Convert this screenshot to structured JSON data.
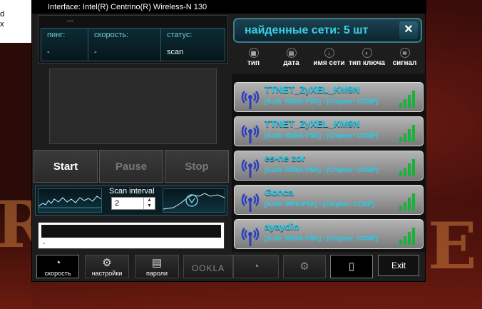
{
  "desktop": {
    "left_text_1": "d",
    "left_text_2": "x"
  },
  "window": {
    "title": "Interface:  Intel(R) Centrino(R) Wireless-N 130"
  },
  "connection": {
    "top_value": "---",
    "headers": [
      "пинг:",
      "скорость:",
      "статус:"
    ],
    "values": [
      "-",
      "-",
      "scan"
    ]
  },
  "controls": {
    "start": "Start",
    "pause": "Pause",
    "stop": "Stop"
  },
  "scan": {
    "label": "Scan interval",
    "value": "2"
  },
  "log": {
    "first_line": "-"
  },
  "networks_header": {
    "label": "найденные сети:",
    "count": "5",
    "unit": "шт"
  },
  "columns": [
    "тип",
    "дата",
    "имя сети",
    "тип ключа",
    "сигнал"
  ],
  "networks": [
    {
      "name": "TTNET_ZyXEL_KM9N",
      "auth": "[Auth: RSNA-PSK] - [Chipher: CCMP]"
    },
    {
      "name": "TTNET_ZyXEL_KM9N",
      "auth": "[Auth: RSNA-PSK] - [Chipher: CCMP]"
    },
    {
      "name": "es-ne zor",
      "auth": "[Auth: RSNA-PSK] - [Chipher: CCMP]"
    },
    {
      "name": "Gonca",
      "auth": "[Auth: WPA-PSK] - [Chipher: CCMP]"
    },
    {
      "name": "ayaydin",
      "auth": "[Auth: RSNA-PSK] - [Chipher: CCMP]"
    }
  ],
  "toolbar": {
    "speed": "скорость",
    "settings": "настройки",
    "passwords": "пароли",
    "ookla": "OOKLA",
    "exit": "Exit"
  },
  "colors": {
    "accent": "#1fd0f0",
    "panel": "#1d1d1d"
  }
}
